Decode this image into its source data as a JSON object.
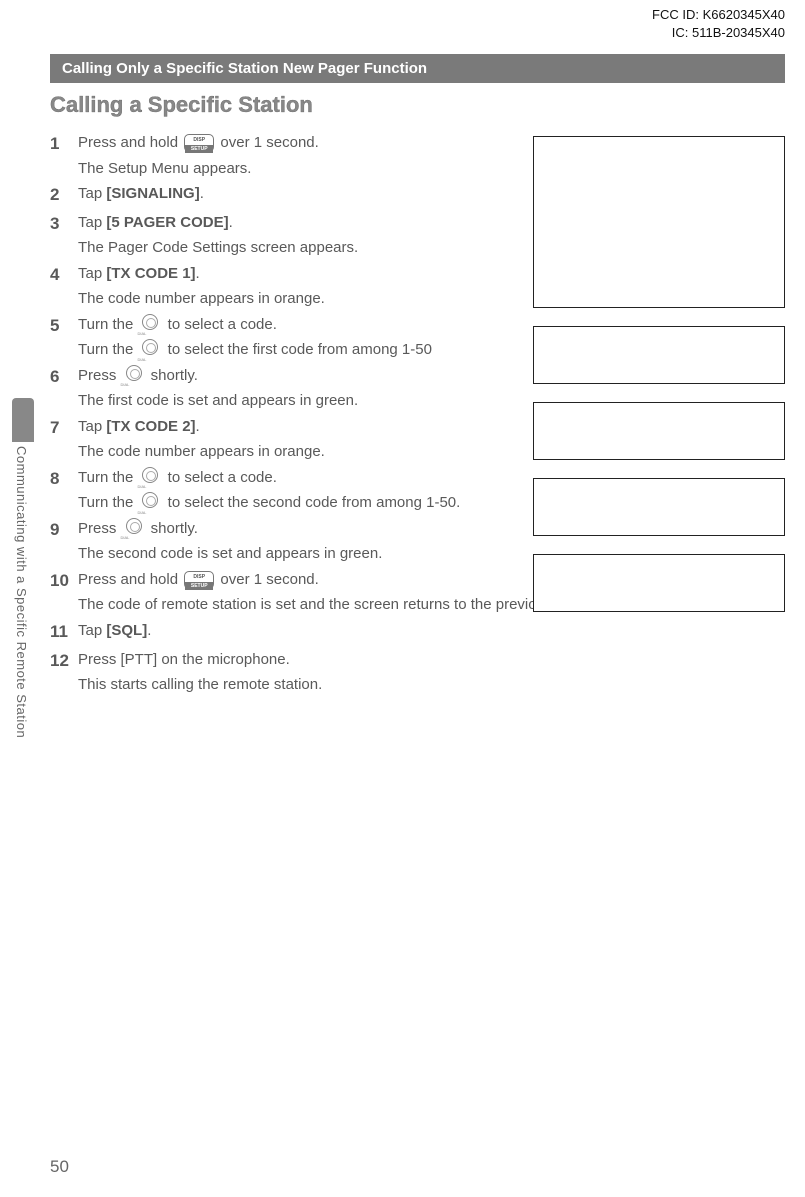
{
  "header": {
    "fcc": "FCC ID: K6620345X40",
    "ic": "IC: 511B-20345X40"
  },
  "sectionBar": "Calling Only a Specific Station   New Pager Function",
  "sectionTitle": "Calling a Specific Station",
  "sideLabel": "Communicating with a Specific Remote Station",
  "pageNumber": "50",
  "steps": {
    "s1a": "Press and hold ",
    "s1b": " over 1 second.",
    "s1sub": "The Setup Menu appears.",
    "s2a": "Tap ",
    "s2b": "[SIGNALING]",
    "s2c": ".",
    "s3a": "Tap ",
    "s3b": "[5 PAGER CODE]",
    "s3c": ".",
    "s3sub": "The Pager Code Settings screen appears.",
    "s4a": "Tap ",
    "s4b": "[TX CODE 1]",
    "s4c": ".",
    "s4sub": "The code number appears in orange.",
    "s5a": "Turn the ",
    "s5b": " to select a code.",
    "s5sub_a": "Turn the ",
    "s5sub_b": " to select the first code from among 1-50",
    "s6a": "Press ",
    "s6b": " shortly.",
    "s6sub": "The first code is set and appears in green.",
    "s7a": "Tap ",
    "s7b": "[TX CODE 2]",
    "s7c": ".",
    "s7sub": "The code number appears in orange.",
    "s8a": "Turn the ",
    "s8b": " to select a code.",
    "s8sub_a": "Turn the ",
    "s8sub_b": " to select the second code from among 1-50.",
    "s9a": "Press ",
    "s9b": " shortly.",
    "s9sub": "The second code is set and appears in green.",
    "s10a": "Press and hold ",
    "s10b": " over 1 second.",
    "s10sub": "The code of remote station is set and the screen returns to the previous one.",
    "s11a": "Tap ",
    "s11b": "[SQL]",
    "s11c": ".",
    "s12": "Press [PTT] on the microphone.",
    "s12sub": "This starts calling the remote station."
  }
}
